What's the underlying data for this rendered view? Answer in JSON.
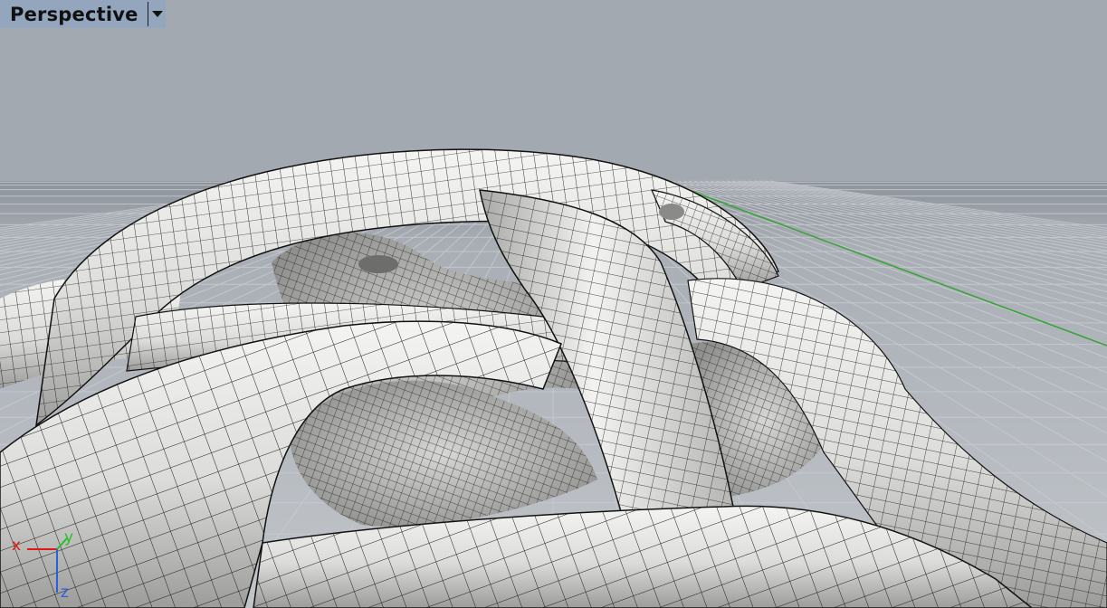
{
  "viewport": {
    "title": "Perspective",
    "menu_icon": "chevron-down-icon",
    "display_mode": "shaded-mesh-wireframe"
  },
  "gizmo": {
    "x_label": "x",
    "y_label": "y",
    "z_label": "z",
    "x_color": "#e01818",
    "y_color": "#27c127",
    "z_color": "#2c5ee0"
  },
  "colors": {
    "sky": "#a3a9b1",
    "ground": "#b7bcc2",
    "grid_line": "#c8ccd2",
    "y_axis_line": "#3aa33a",
    "surface": "#e2e2e0",
    "mesh_line": "#1c1c1c",
    "tab_bg": "#94a6bd"
  }
}
